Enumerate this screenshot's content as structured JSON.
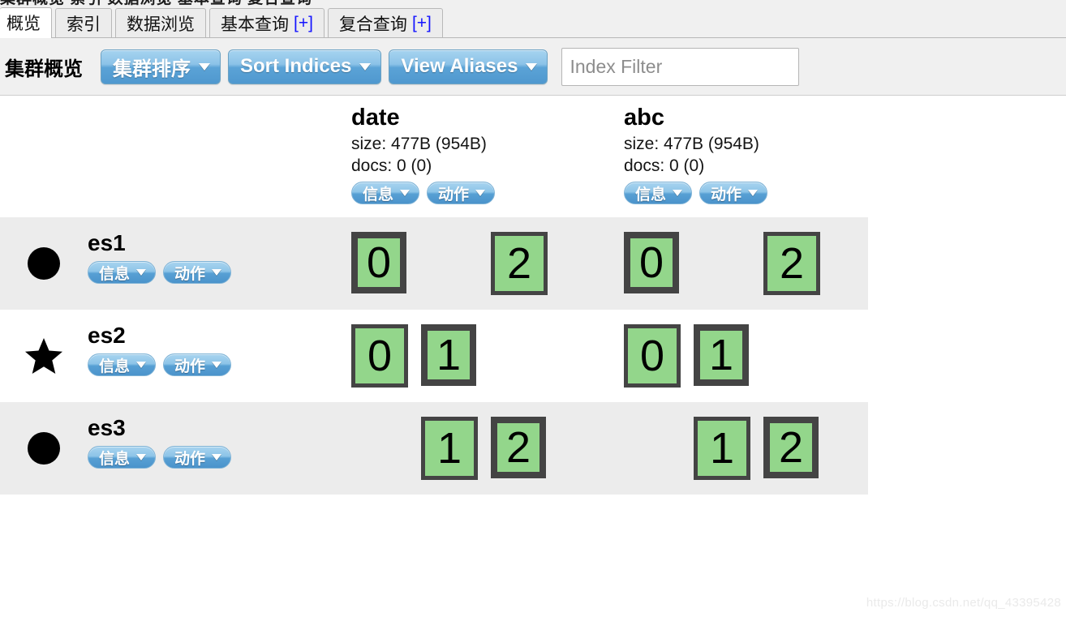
{
  "window": {
    "cut_off_top_text": "集群概览  索引  数据浏览  基本查询  复合查询"
  },
  "tabs": [
    {
      "label": "概览",
      "suffix": "",
      "active": true
    },
    {
      "label": "索引",
      "suffix": "",
      "active": false
    },
    {
      "label": "数据浏览",
      "suffix": "",
      "active": false
    },
    {
      "label": "基本查询",
      "suffix": "[+]",
      "active": false
    },
    {
      "label": "复合查询",
      "suffix": "[+]",
      "active": false
    }
  ],
  "toolbar": {
    "title": "集群概览",
    "buttons": [
      {
        "label": "集群排序",
        "icon": "chevron-down-icon"
      },
      {
        "label": "Sort Indices",
        "icon": "chevron-down-icon"
      },
      {
        "label": "View Aliases",
        "icon": "chevron-down-icon"
      }
    ],
    "filter": {
      "placeholder": "Index Filter",
      "value": ""
    }
  },
  "colors": {
    "accent_blue": "#5ba3d6",
    "shard_green": "#93d68b",
    "shard_border": "#444444",
    "stripe": "#ececec",
    "tab_bar": "#f0f0f0",
    "link_blue": "#1414ff"
  },
  "table": {
    "indices": [
      {
        "name": "date",
        "size_label": "size: 477B (954B)",
        "docs_label": "docs: 0 (0)",
        "actions": [
          {
            "label": "信息",
            "icon": "chevron-down-icon"
          },
          {
            "label": "动作",
            "icon": "chevron-down-icon"
          }
        ]
      },
      {
        "name": "abc",
        "size_label": "size: 477B (954B)",
        "docs_label": "docs: 0 (0)",
        "actions": [
          {
            "label": "信息",
            "icon": "chevron-down-icon"
          },
          {
            "label": "动作",
            "icon": "chevron-down-icon"
          }
        ]
      }
    ],
    "nodes": [
      {
        "name": "es1",
        "marker": "circle-icon",
        "striped": true,
        "actions": [
          {
            "label": "信息",
            "icon": "chevron-down-icon"
          },
          {
            "label": "动作",
            "icon": "chevron-down-icon"
          }
        ],
        "shards": [
          [
            {
              "slot": 0,
              "label": "0",
              "type": "primary"
            },
            {
              "slot": 2,
              "label": "2",
              "type": "replica"
            }
          ],
          [
            {
              "slot": 0,
              "label": "0",
              "type": "primary"
            },
            {
              "slot": 2,
              "label": "2",
              "type": "replica"
            }
          ]
        ]
      },
      {
        "name": "es2",
        "marker": "star-icon",
        "striped": false,
        "actions": [
          {
            "label": "信息",
            "icon": "chevron-down-icon"
          },
          {
            "label": "动作",
            "icon": "chevron-down-icon"
          }
        ],
        "shards": [
          [
            {
              "slot": 0,
              "label": "0",
              "type": "replica"
            },
            {
              "slot": 1,
              "label": "1",
              "type": "primary"
            }
          ],
          [
            {
              "slot": 0,
              "label": "0",
              "type": "replica"
            },
            {
              "slot": 1,
              "label": "1",
              "type": "primary"
            }
          ]
        ]
      },
      {
        "name": "es3",
        "marker": "circle-icon",
        "striped": true,
        "actions": [
          {
            "label": "信息",
            "icon": "chevron-down-icon"
          },
          {
            "label": "动作",
            "icon": "chevron-down-icon"
          }
        ],
        "shards": [
          [
            {
              "slot": 1,
              "label": "1",
              "type": "replica"
            },
            {
              "slot": 2,
              "label": "2",
              "type": "primary"
            }
          ],
          [
            {
              "slot": 1,
              "label": "1",
              "type": "replica"
            },
            {
              "slot": 2,
              "label": "2",
              "type": "primary"
            }
          ]
        ]
      }
    ]
  },
  "watermark": "https://blog.csdn.net/qq_43395428"
}
